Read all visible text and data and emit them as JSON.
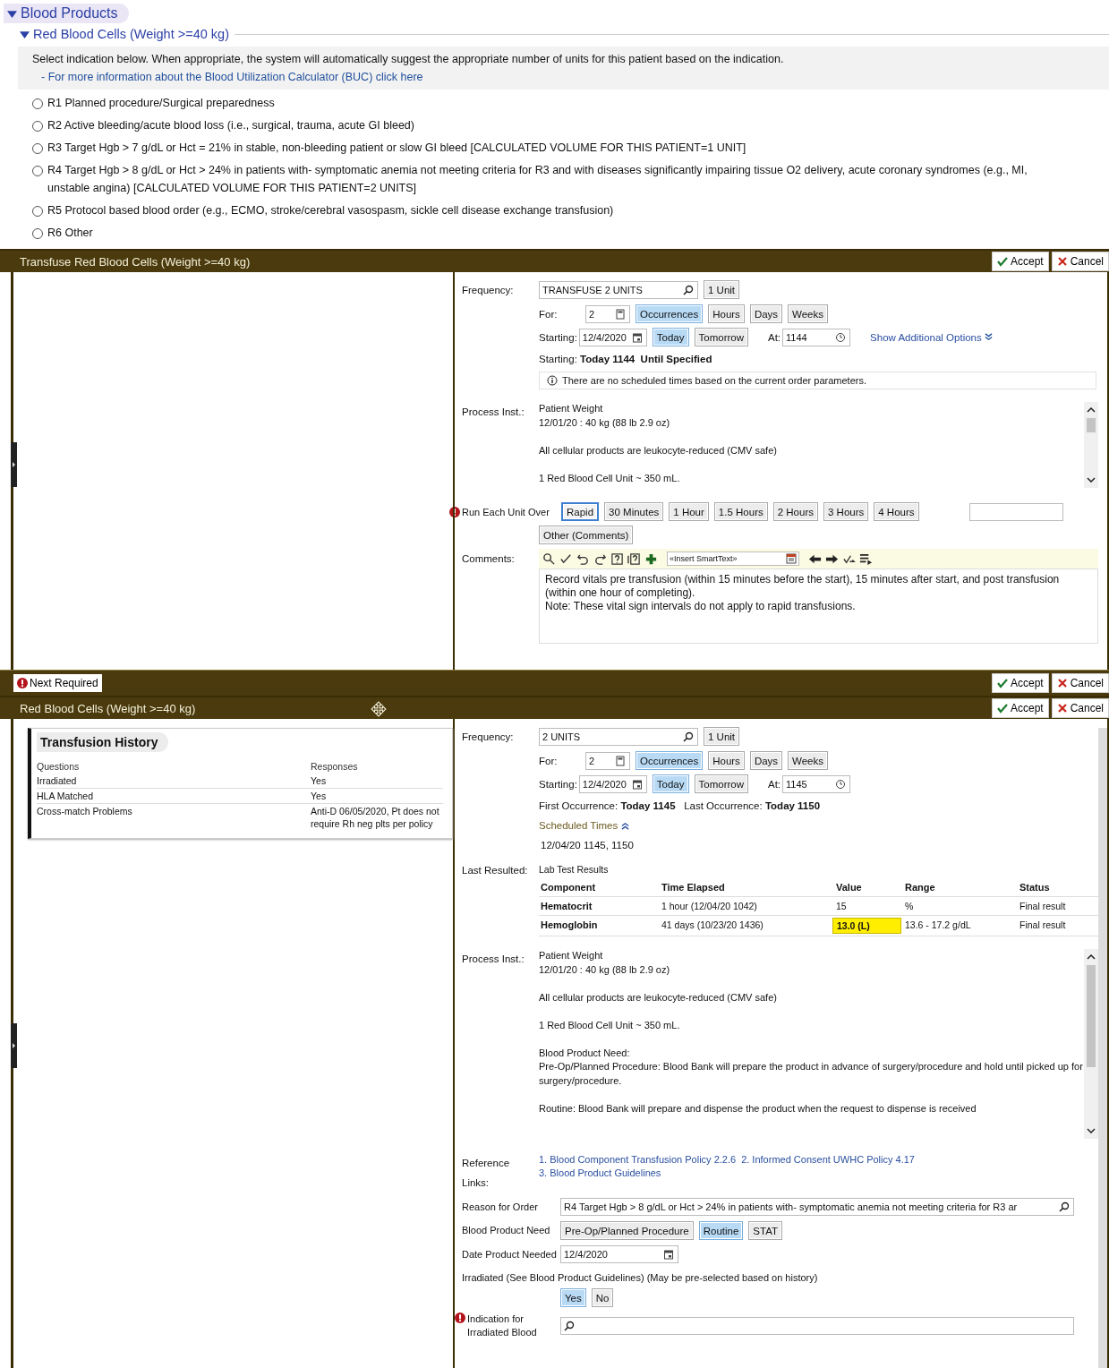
{
  "section": {
    "title": "Blood Products",
    "expanded": true
  },
  "subsection": {
    "title": "Red Blood Cells (Weight >=40 kg)",
    "expanded": true
  },
  "intro": "Select indication below.  When appropriate, the system will automatically suggest the appropriate number of units for this patient based on the indication.",
  "info_link": "- For more information about the Blood Utilization Calculator (BUC) click here",
  "indications": [
    {
      "label": "R1 Planned procedure/Surgical preparedness",
      "selected": false
    },
    {
      "label": "R2 Active bleeding/acute blood loss (i.e., surgical, trauma, acute GI bleed)",
      "selected": false
    },
    {
      "label": "R3 Target Hgb > 7 g/dL or Hct = 21% in stable, non-bleeding patient or slow GI bleed [CALCULATED VOLUME FOR THIS PATIENT=1 UNIT]",
      "selected": false
    },
    {
      "label": "R4 Target Hgb > 8 g/dL or Hct > 24% in patients with- symptomatic anemia not meeting criteria for R3 and with diseases significantly impairing tissue O2 delivery, acute coronary syndromes (e.g., MI, unstable angina) [CALCULATED VOLUME FOR THIS PATIENT=2 UNITS]",
      "selected": false
    },
    {
      "label": "R5 Protocol based blood order (e.g., ECMO, stroke/cerebral vasospasm, sickle cell disease exchange transfusion)",
      "selected": false
    },
    {
      "label": "R6 Other",
      "selected": false
    }
  ],
  "orders": [
    {
      "title": "Transfuse Red Blood Cells (Weight >=40 kg)",
      "buttons": [
        {
          "label": "Accept",
          "kind": "accept"
        },
        {
          "label": "Cancel",
          "kind": "cancel"
        }
      ],
      "frequency_label": "Frequency:",
      "frequency": "TRANSFUSE 2 UNITS",
      "unit_button": "1 Unit",
      "for_label": "For:",
      "for_value": "2",
      "for_options": [
        {
          "label": "Occurrences",
          "selected": true
        },
        {
          "label": "Hours",
          "selected": false
        },
        {
          "label": "Days",
          "selected": false
        },
        {
          "label": "Weeks",
          "selected": false
        }
      ],
      "starting_label": "Starting:",
      "starting_value": "12/4/2020",
      "day_options": [
        {
          "label": "Today",
          "selected": true
        },
        {
          "label": "Tomorrow",
          "selected": false
        }
      ],
      "at_label": "At:",
      "at_value": "1144",
      "more_link": "Show Additional Options",
      "summary": "Starting: **Today 1144**  **Until Specified**",
      "notice": "There are no scheduled times based on the current order parameters.",
      "process": {
        "label": "Process Inst.:",
        "paragraphs": [
          "Patient Weight\n12/01/20 : 40 kg (88 lb 2.9 oz)",
          "All cellular products are leukocyte-reduced (CMV safe)",
          "1 Red Blood Cell Unit ~ 350 mL."
        ]
      },
      "run_over": {
        "label": "Run Each Unit Over",
        "required": true,
        "options": [
          {
            "label": "Rapid",
            "focused": true
          },
          {
            "label": "30 Minutes",
            "focused": false
          },
          {
            "label": "1 Hour",
            "focused": false
          },
          {
            "label": "1.5 Hours",
            "focused": false
          },
          {
            "label": "2 Hours",
            "focused": false
          },
          {
            "label": "3 Hours",
            "focused": false
          },
          {
            "label": "4 Hours",
            "focused": false
          }
        ],
        "other": "Other (Comments)"
      },
      "comments": {
        "label": "Comments:",
        "smarttext": "«Insert SmartText»",
        "text": "Record vitals pre transfusion (within 15 minutes before the start), 15 minutes after start, and post transfusion (within one hour of completing).\nNote: These vital sign intervals do not apply to rapid transfusions."
      },
      "footer": {
        "next_required": "Next Required",
        "buttons": [
          {
            "label": "Accept",
            "kind": "accept"
          },
          {
            "label": "Cancel",
            "kind": "cancel"
          }
        ]
      }
    },
    {
      "title": "Red Blood Cells (Weight >=40 kg)",
      "buttons": [
        {
          "label": "Accept",
          "kind": "accept"
        },
        {
          "label": "Cancel",
          "kind": "cancel"
        }
      ],
      "history": {
        "title": "Transfusion History",
        "columns": [
          "Questions",
          "Responses"
        ],
        "rows": [
          [
            "Irradiated",
            "Yes"
          ],
          [
            "HLA Matched",
            "Yes"
          ],
          [
            "Cross-match Problems",
            "Anti-D 06/05/2020, Pt does not require Rh neg plts per policy"
          ]
        ]
      },
      "frequency_label": "Frequency:",
      "frequency": "2 UNITS",
      "unit_button": "1 Unit",
      "for_label": "For:",
      "for_value": "2",
      "for_options": [
        {
          "label": "Occurrences",
          "selected": true
        },
        {
          "label": "Hours",
          "selected": false
        },
        {
          "label": "Days",
          "selected": false
        },
        {
          "label": "Weeks",
          "selected": false
        }
      ],
      "starting_label": "Starting:",
      "starting_value": "12/4/2020",
      "day_options": [
        {
          "label": "Today",
          "selected": true
        },
        {
          "label": "Tomorrow",
          "selected": false
        }
      ],
      "at_label": "At:",
      "at_value": "1145",
      "summary": "First Occurrence: **Today 1145**   Last Occurrence: **Today 1150**",
      "scheduled": {
        "label": "Scheduled Times",
        "expanded": true,
        "value": "12/04/20  1145, 1150"
      },
      "labs": {
        "label": "Last Resulted:",
        "title": "Lab Test Results",
        "columns": [
          "Component",
          "Time Elapsed",
          "Value",
          "Range",
          "Status"
        ],
        "rows": [
          {
            "cells": [
              "Hematocrit",
              "1 hour (12/04/20 1042)",
              "15",
              "%",
              "Final result"
            ],
            "abnormal": false
          },
          {
            "cells": [
              "Hemoglobin",
              "41 days (10/23/20 1436)",
              "13.0 (L)",
              "13.6 - 17.2 g/dL",
              "Final result"
            ],
            "abnormal": true
          }
        ]
      },
      "process": {
        "label": "Process Inst.:",
        "paragraphs": [
          "Patient Weight\n12/01/20 : 40 kg (88 lb 2.9 oz)",
          "All cellular products are leukocyte-reduced (CMV safe)",
          "1 Red Blood Cell Unit ~ 350 mL.",
          "Blood Product Need:\nPre-Op/Planned Procedure: Blood Bank will prepare the product in advance of surgery/procedure and hold until picked up for surgery/procedure.",
          "Routine: Blood Bank will prepare and dispense the product when the request to dispense is received"
        ]
      },
      "references": {
        "label": "Reference Links:",
        "links": [
          "1. Blood Component Transfusion Policy 2.2.6",
          "2. Informed Consent UWHC Policy 4.17",
          "3. Blood Product Guidelines"
        ]
      },
      "reason": {
        "label": "Reason for Order",
        "value": "R4 Target Hgb > 8 g/dL or Hct > 24% in patients with- symptomatic anemia not meeting criteria for R3 ar"
      },
      "need": {
        "label": "Blood Product Need",
        "options": [
          {
            "label": "Pre-Op/Planned Procedure",
            "selected": false
          },
          {
            "label": "Routine",
            "selected": true
          },
          {
            "label": "STAT",
            "selected": false
          }
        ]
      },
      "date_needed": {
        "label": "Date Product Needed",
        "value": "12/4/2020"
      },
      "irradiated": {
        "label": "Irradiated (See Blood Product Guidelines) (May be pre-selected based on history)",
        "options": [
          {
            "label": "Yes",
            "selected": true
          },
          {
            "label": "No",
            "selected": false
          }
        ]
      },
      "indication": {
        "label": "Indication for Irradiated Blood",
        "required": true
      }
    }
  ]
}
